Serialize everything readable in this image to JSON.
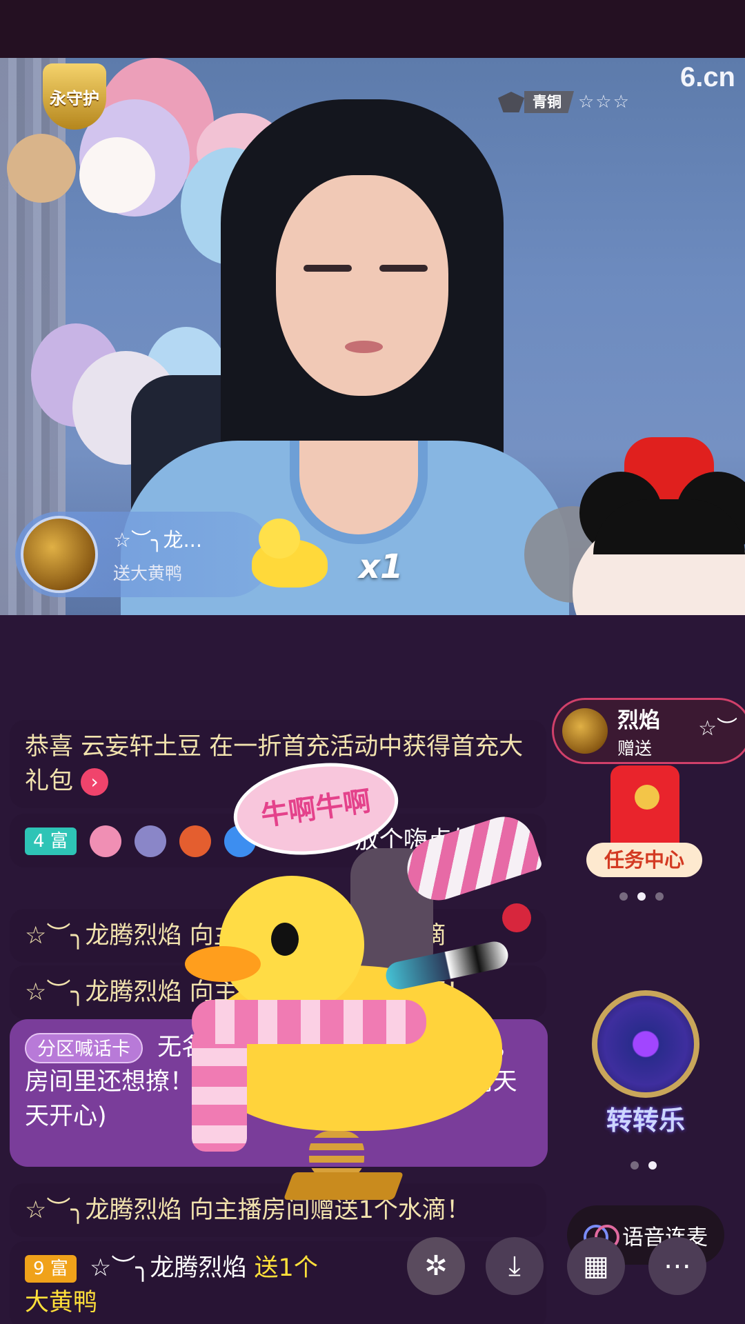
{
  "stream": {
    "logo": "6.cn",
    "guard_badge": "永守护",
    "rank_label": "青铜",
    "rank_stars": "☆☆☆",
    "gift_notice": {
      "user": "☆︶╮龙...",
      "action": "送大黄鸭",
      "multiplier": "x1"
    }
  },
  "chat": {
    "messages": [
      {
        "text": "恭喜 云妄轩土豆 在一折首充活动中获得首充大礼包"
      },
      {
        "level": "4 富",
        "text": "刀☆心: 放个嗨点的"
      },
      {
        "text": "☆︶╮龙腾烈焰 向主播房间赠送1个水滴"
      },
      {
        "text": "☆︶╮龙腾烈焰 向主播房间赠送1个水滴！"
      },
      {
        "text": "☆︶╮龙腾烈焰 向主播房间赠送1个水滴！"
      },
      {
        "level": "9 富",
        "user": "☆︶╮龙腾烈焰",
        "text": "送1个大黄鸭"
      }
    ],
    "shout": {
      "tag": "分区喊话卡",
      "text": "无名：一大长腿，前不凸后不翘，房间里还想撩！这主播赶紧走吧！(来自雪莉天天开心)"
    }
  },
  "sidebar": {
    "gift_user": "烈焰",
    "gift_action": "赠送",
    "gift_star": "☆︶",
    "task_center": "任务中心",
    "wheel": "转转乐",
    "voice_link": "语音连麦"
  },
  "animation": {
    "bubble_text": "牛啊牛啊"
  },
  "icons": [
    "pinwheel-icon",
    "download-icon",
    "grid-icon",
    "more-icon"
  ],
  "colors": {
    "bg": "#22102a",
    "accent": "#f0446c",
    "chat_text": "#f2e3ae"
  }
}
